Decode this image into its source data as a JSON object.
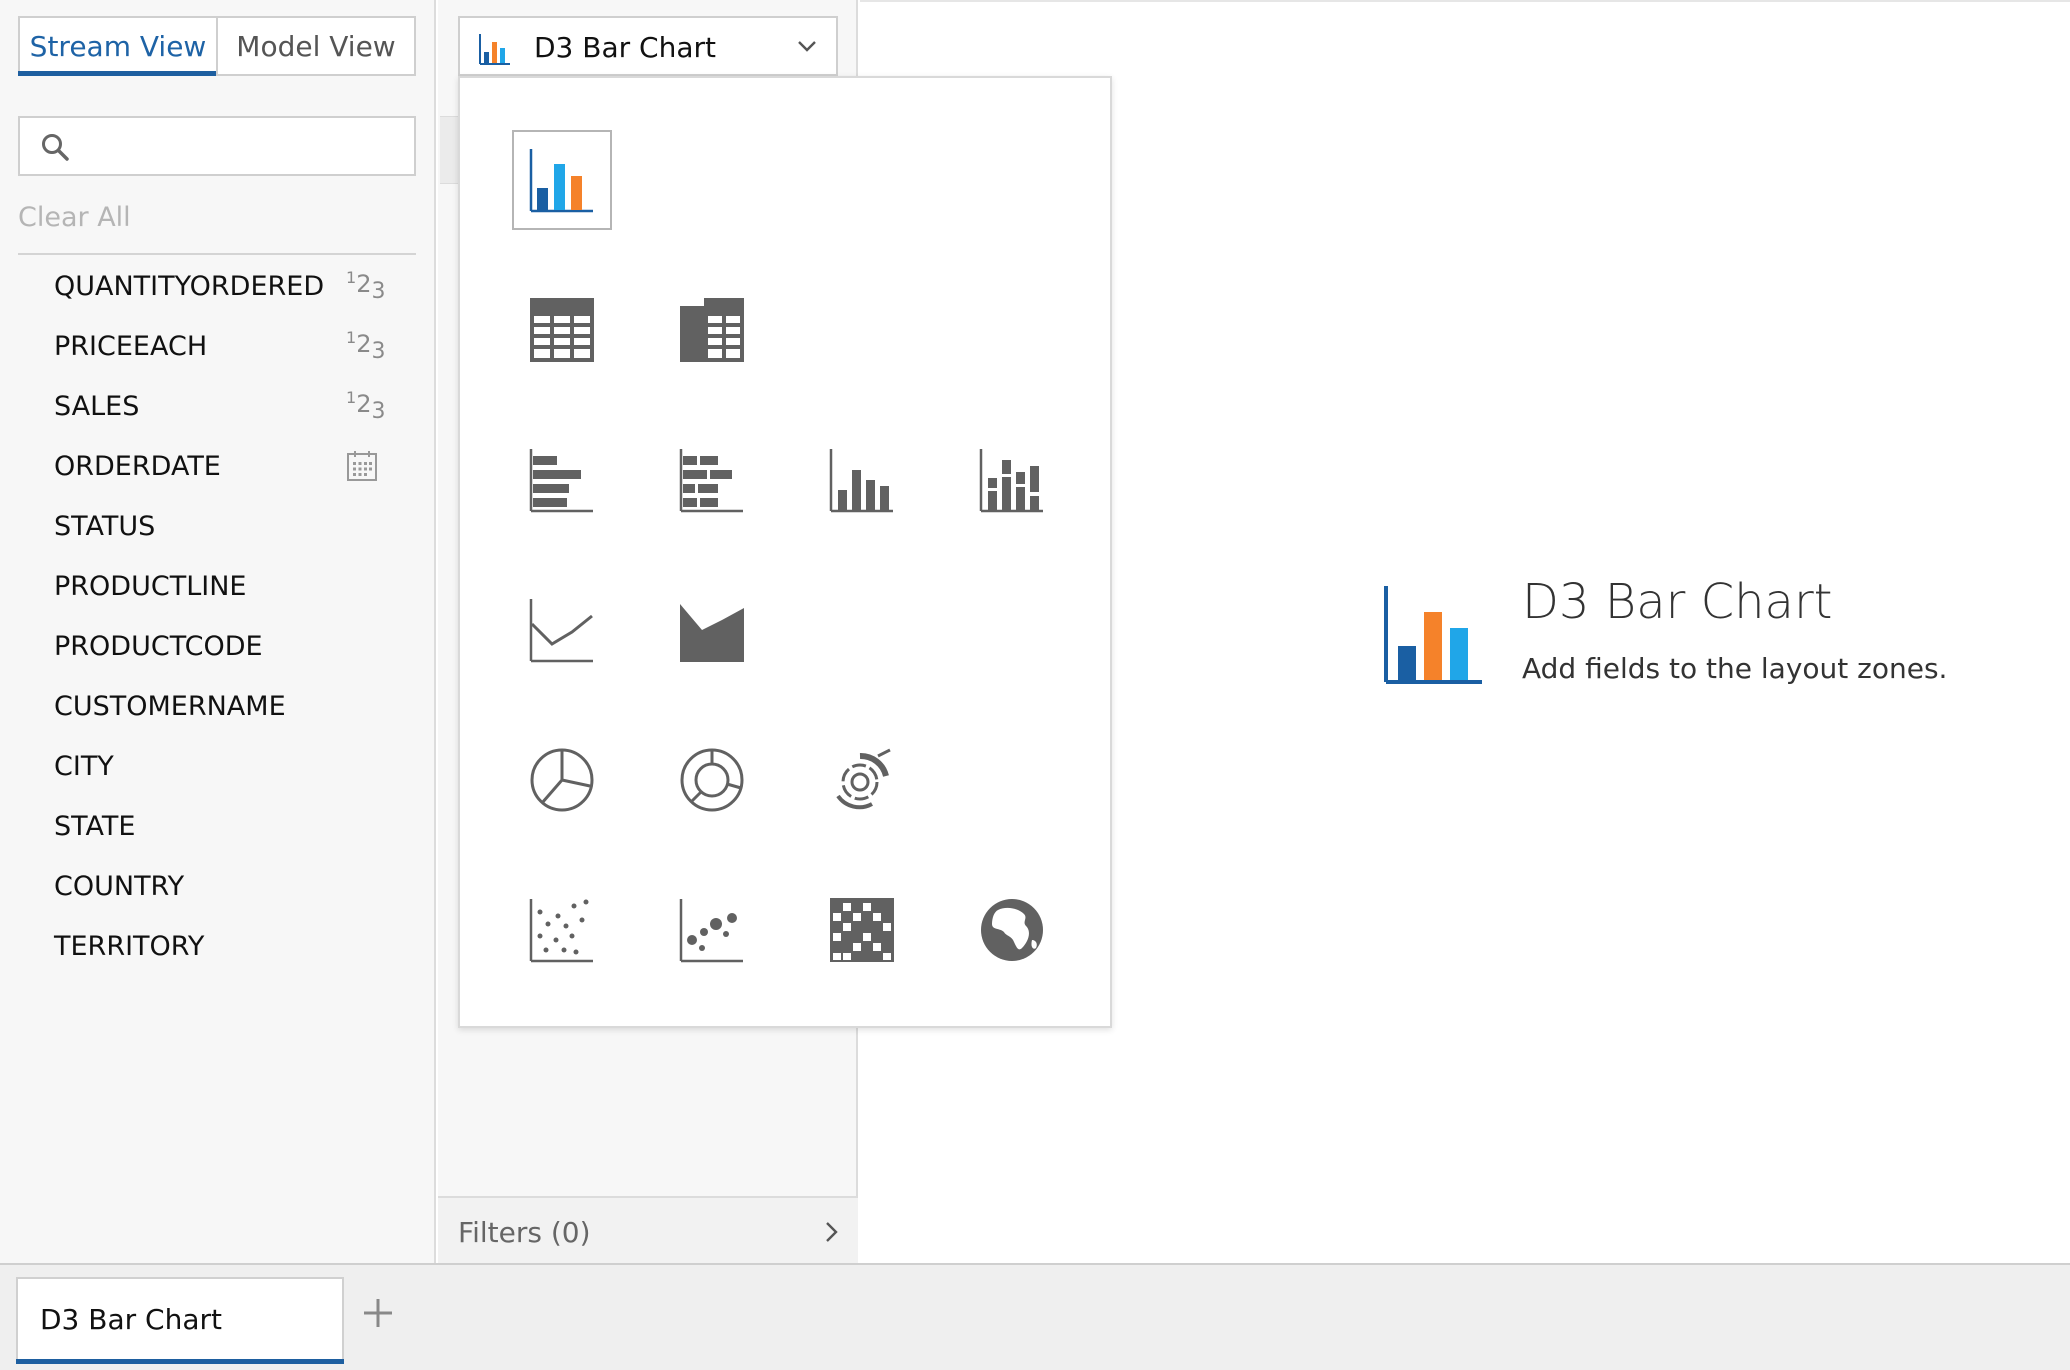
{
  "view_tabs": [
    {
      "label": "Stream View",
      "active": true
    },
    {
      "label": "Model View",
      "active": false
    }
  ],
  "search": {
    "placeholder": "",
    "value": ""
  },
  "clear_all": "Clear All",
  "fields": [
    {
      "name": "QUANTITYORDERED",
      "type": "numeric",
      "badge": {
        "sup": "1",
        "mid": "2",
        "sub": "3"
      }
    },
    {
      "name": "PRICEEACH",
      "type": "numeric",
      "badge": {
        "sup": "1",
        "mid": "2",
        "sub": "3"
      }
    },
    {
      "name": "SALES",
      "type": "numeric",
      "badge": {
        "sup": "1",
        "mid": "2",
        "sub": "3"
      }
    },
    {
      "name": "ORDERDATE",
      "type": "date",
      "icon": "calendar-icon"
    },
    {
      "name": "STATUS",
      "type": "text"
    },
    {
      "name": "PRODUCTLINE",
      "type": "text"
    },
    {
      "name": "PRODUCTCODE",
      "type": "text"
    },
    {
      "name": "CUSTOMERNAME",
      "type": "text"
    },
    {
      "name": "CITY",
      "type": "text"
    },
    {
      "name": "STATE",
      "type": "text"
    },
    {
      "name": "COUNTRY",
      "type": "text"
    },
    {
      "name": "TERRITORY",
      "type": "text"
    }
  ],
  "chart_selector": {
    "label": "D3 Bar Chart",
    "icon": "bar-chart-icon"
  },
  "chart_types": [
    {
      "icon": "d3-bar-chart-icon",
      "selected": true
    },
    {
      "icon": "table-icon"
    },
    {
      "icon": "crosstab-table-icon"
    },
    {
      "icon": "horizontal-bar-icon"
    },
    {
      "icon": "stacked-horizontal-bar-icon"
    },
    {
      "icon": "column-chart-icon"
    },
    {
      "icon": "stacked-column-chart-icon"
    },
    {
      "icon": "line-chart-icon"
    },
    {
      "icon": "area-chart-icon"
    },
    {
      "icon": "pie-chart-icon"
    },
    {
      "icon": "donut-chart-icon"
    },
    {
      "icon": "sunburst-chart-icon"
    },
    {
      "icon": "scatter-plot-icon"
    },
    {
      "icon": "bubble-chart-icon"
    },
    {
      "icon": "heatmap-icon"
    },
    {
      "icon": "geo-map-icon"
    }
  ],
  "filters": {
    "label": "Filters (0)"
  },
  "empty_state": {
    "title": "D3 Bar Chart",
    "subtitle": "Add fields to the layout zones."
  },
  "report_tabs": [
    {
      "label": "D3 Bar Chart",
      "active": true
    }
  ],
  "colors": {
    "accent": "#1e5fa0",
    "bar_blue": "#1a5fa3",
    "bar_orange": "#f5822a",
    "bar_cyan": "#20a6e8",
    "icon_gray": "#616161"
  }
}
